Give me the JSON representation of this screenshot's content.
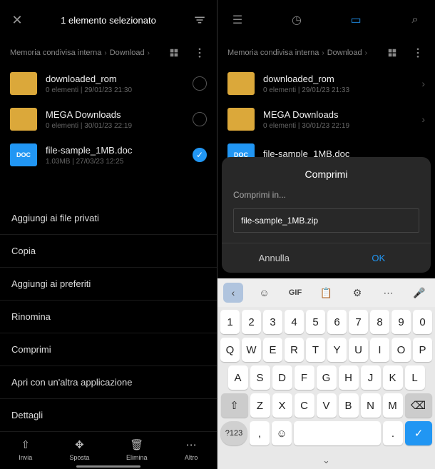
{
  "left": {
    "header_title": "1 elemento selezionato",
    "breadcrumb": [
      "Memoria condivisa interna",
      "Download"
    ],
    "files": [
      {
        "name": "downloaded_rom",
        "meta": "0 elementi  |  29/01/23 21:30",
        "type": "folder",
        "checked": false
      },
      {
        "name": "MEGA Downloads",
        "meta": "0 elementi  |  30/01/23 22:19",
        "type": "folder",
        "checked": false
      },
      {
        "name": "file-sample_1MB.doc",
        "meta": "1.03MB  |  27/03/23 12:25",
        "type": "doc",
        "checked": true
      }
    ],
    "menu": [
      "Aggiungi ai file privati",
      "Copia",
      "Aggiungi ai preferiti",
      "Rinomina",
      "Comprimi",
      "Apri con un'altra applicazione",
      "Dettagli"
    ],
    "bottom": {
      "send": "Invia",
      "move": "Sposta",
      "delete": "Elimina",
      "more": "Altro"
    }
  },
  "right": {
    "breadcrumb": [
      "Memoria condivisa interna",
      "Download"
    ],
    "files": [
      {
        "name": "downloaded_rom",
        "meta": "0 elementi  |  29/01/23 21:33",
        "type": "folder"
      },
      {
        "name": "MEGA Downloads",
        "meta": "0 elementi  |  30/01/23 22:19",
        "type": "folder"
      },
      {
        "name": "file-sample_1MB.doc",
        "meta": "",
        "type": "doc"
      }
    ],
    "dialog": {
      "title": "Comprimi",
      "subtitle": "Comprimi in...",
      "input_value": "file-sample_1MB.zip",
      "cancel": "Annulla",
      "ok": "OK"
    },
    "keyboard": {
      "gif": "GIF",
      "sym": "?123",
      "rows": [
        [
          "1",
          "2",
          "3",
          "4",
          "5",
          "6",
          "7",
          "8",
          "9",
          "0"
        ],
        [
          "Q",
          "W",
          "E",
          "R",
          "T",
          "Y",
          "U",
          "I",
          "O",
          "P"
        ],
        [
          "A",
          "S",
          "D",
          "F",
          "G",
          "H",
          "J",
          "K",
          "L"
        ],
        [
          "Z",
          "X",
          "C",
          "V",
          "B",
          "N",
          "M"
        ]
      ]
    }
  },
  "doc_label": "DOC"
}
